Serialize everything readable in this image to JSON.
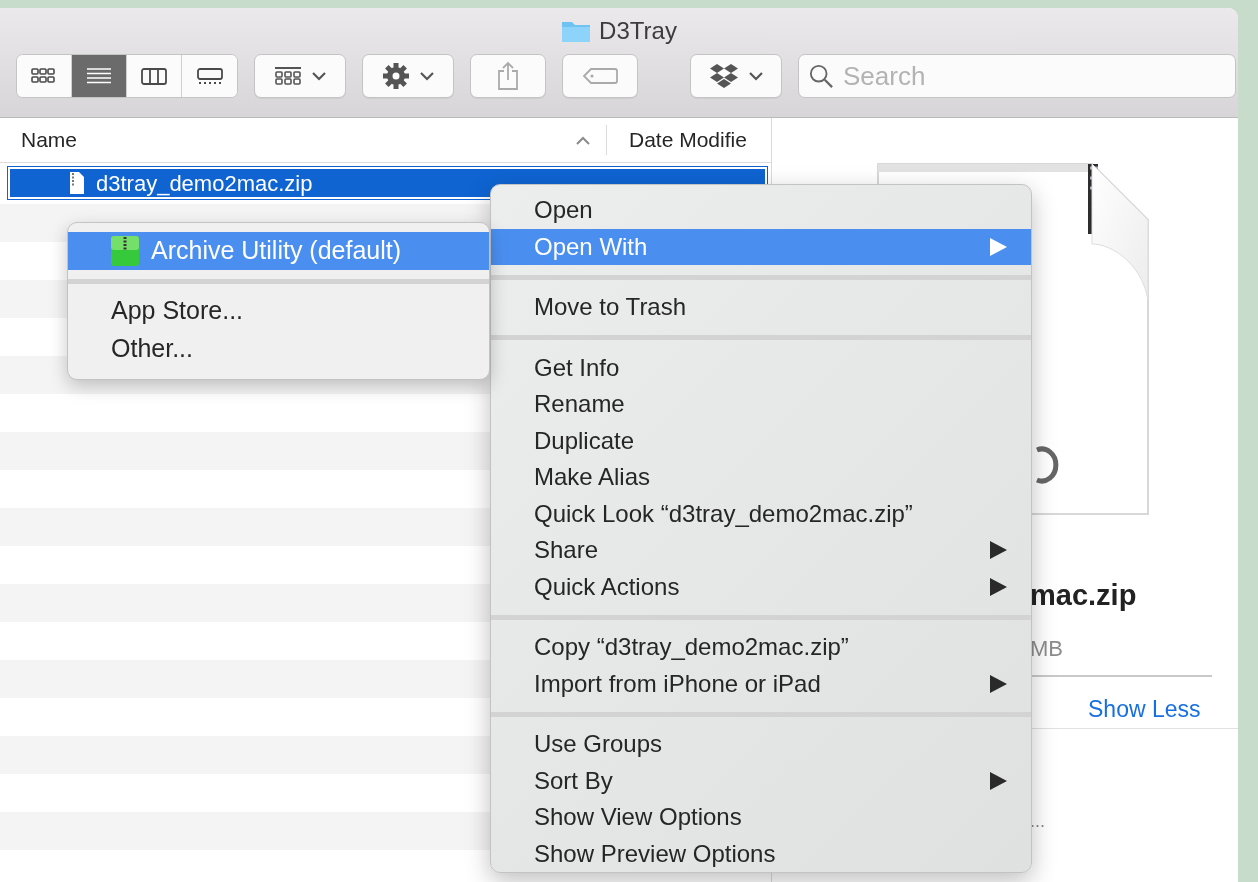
{
  "window": {
    "title": "D3Tray"
  },
  "toolbar": {
    "view_modes": [
      {
        "kind": "icons",
        "selected": false
      },
      {
        "kind": "list",
        "selected": true
      },
      {
        "kind": "columns",
        "selected": false
      },
      {
        "kind": "gallery",
        "selected": false
      }
    ],
    "search": {
      "placeholder": "Search"
    }
  },
  "list": {
    "columns": [
      "Name",
      "Date Modifie"
    ],
    "rows": [
      {
        "name": "d3tray_demo2mac.zip",
        "selected": true
      }
    ]
  },
  "preview": {
    "name": "mac.zip",
    "size": "MB",
    "toggle_link": "Show Less",
    "more": "..."
  },
  "context_menu": {
    "groups": [
      [
        {
          "label": "Open",
          "submenu": false,
          "selected": false
        },
        {
          "label": "Open With",
          "submenu": true,
          "selected": true
        }
      ],
      [
        {
          "label": "Move to Trash",
          "submenu": false,
          "selected": false
        }
      ],
      [
        {
          "label": "Get Info",
          "submenu": false,
          "selected": false
        },
        {
          "label": "Rename",
          "submenu": false,
          "selected": false
        },
        {
          "label": "Duplicate",
          "submenu": false,
          "selected": false
        },
        {
          "label": "Make Alias",
          "submenu": false,
          "selected": false
        },
        {
          "label": "Quick Look “d3tray_demo2mac.zip”",
          "submenu": false,
          "selected": false
        },
        {
          "label": "Share",
          "submenu": true,
          "selected": false
        },
        {
          "label": "Quick Actions",
          "submenu": true,
          "selected": false
        }
      ],
      [
        {
          "label": "Copy “d3tray_demo2mac.zip”",
          "submenu": false,
          "selected": false
        },
        {
          "label": "Import from iPhone or iPad",
          "submenu": true,
          "selected": false
        }
      ],
      [
        {
          "label": "Use Groups",
          "submenu": false,
          "selected": false
        },
        {
          "label": "Sort By",
          "submenu": true,
          "selected": false
        },
        {
          "label": "Show View Options",
          "submenu": false,
          "selected": false
        },
        {
          "label": "Show Preview Options",
          "submenu": false,
          "selected": false
        }
      ]
    ]
  },
  "submenu": {
    "groups": [
      [
        {
          "label": "Archive Utility (default)",
          "kind": "app",
          "selected": true
        }
      ],
      [
        {
          "label": "App Store...",
          "kind": "plain",
          "selected": false
        },
        {
          "label": "Other...",
          "kind": "plain",
          "selected": false
        }
      ]
    ]
  }
}
